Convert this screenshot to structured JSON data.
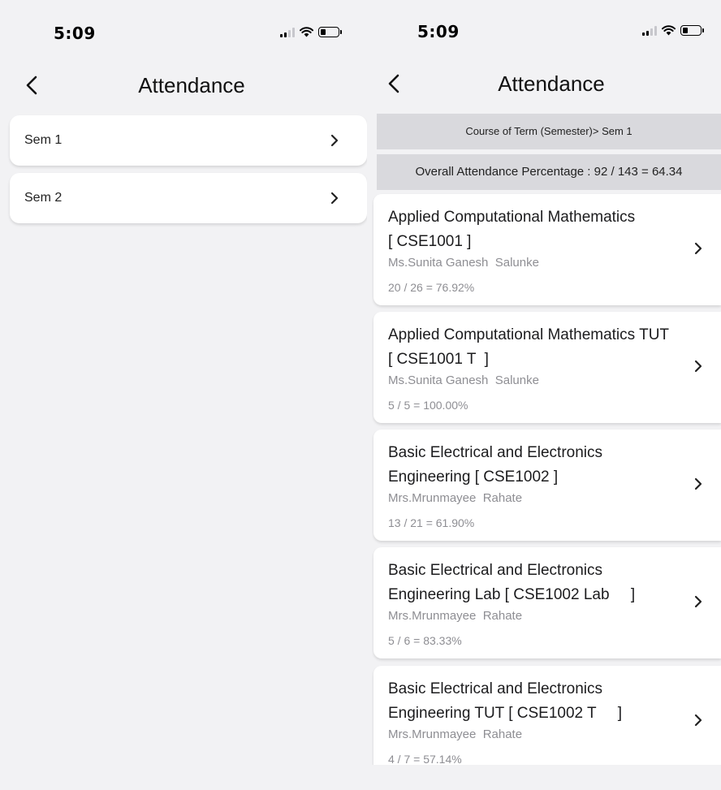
{
  "left_screen": {
    "status": {
      "time": "5:09"
    },
    "nav": {
      "title": "Attendance"
    },
    "semesters": [
      {
        "label": "Sem 1"
      },
      {
        "label": "Sem 2"
      }
    ]
  },
  "right_screen": {
    "status": {
      "time": "5:09"
    },
    "nav": {
      "title": "Attendance"
    },
    "term_banner": "Course of Term (Semester)> Sem 1",
    "overall_banner": "Overall Attendance Percentage : 92 / 143 = 64.34",
    "courses": [
      {
        "title_line1": "Applied Computational Mathematics",
        "title_line2": "[ CSE1001 ]",
        "teacher": "Ms.Sunita Ganesh  Salunke",
        "attendance": "20 / 26 = 76.92%"
      },
      {
        "title_line1": "Applied Computational Mathematics TUT",
        "title_line2": "[ CSE1001 T  ]",
        "teacher": "Ms.Sunita Ganesh  Salunke",
        "attendance": "5 / 5 = 100.00%"
      },
      {
        "title_line1": "Basic Electrical and Electronics",
        "title_line2": "Engineering [ CSE1002 ]",
        "teacher": "Mrs.Mrunmayee  Rahate",
        "attendance": "13 / 21 = 61.90%"
      },
      {
        "title_line1": "Basic Electrical and Electronics",
        "title_line2": "Engineering Lab [ CSE1002 Lab     ]",
        "teacher": "Mrs.Mrunmayee  Rahate",
        "attendance": "5 / 6 = 83.33%"
      },
      {
        "title_line1": "Basic Electrical and Electronics",
        "title_line2": "Engineering TUT [ CSE1002 T     ]",
        "teacher": "Mrs.Mrunmayee  Rahate",
        "attendance": "4 / 7 = 57.14%"
      }
    ]
  },
  "icons": {
    "back": "chevron-left-icon",
    "row_chevron": "chevron-right-icon",
    "signal": "cellular-signal-icon",
    "wifi": "wifi-icon",
    "battery": "battery-icon"
  }
}
